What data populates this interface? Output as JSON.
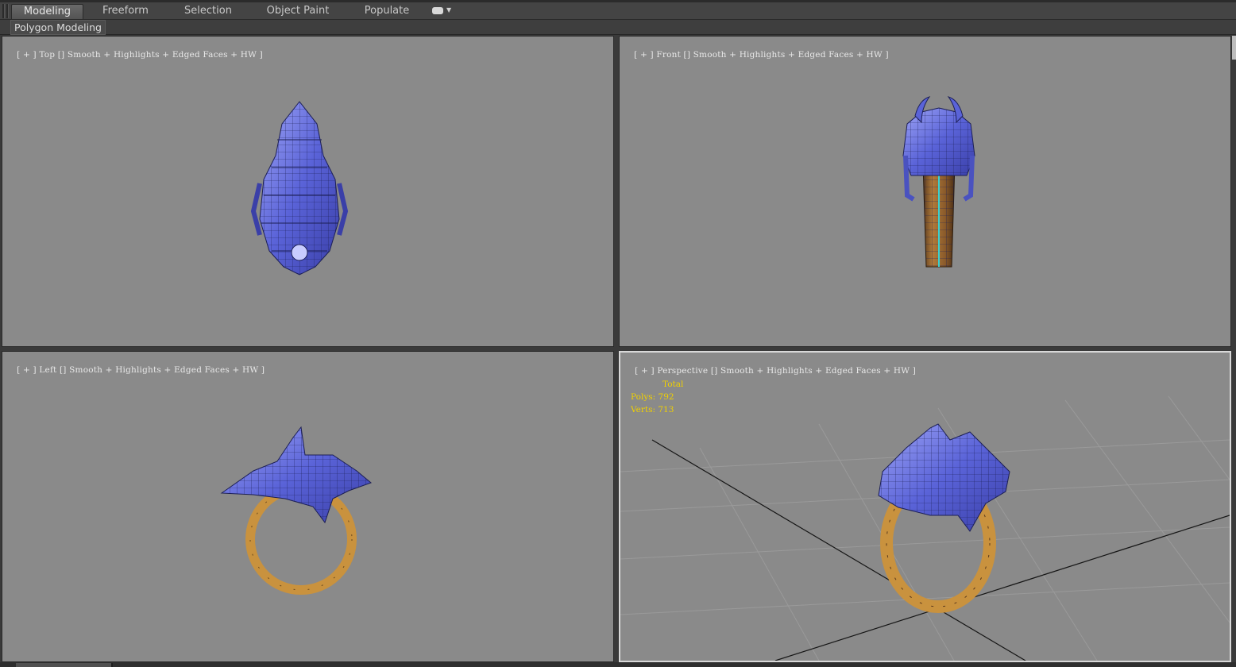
{
  "ribbon": {
    "tabs": [
      {
        "label": "Modeling",
        "active": true
      },
      {
        "label": "Freeform",
        "active": false
      },
      {
        "label": "Selection",
        "active": false
      },
      {
        "label": "Object Paint",
        "active": false
      },
      {
        "label": "Populate",
        "active": false
      }
    ],
    "panel_label": "Polygon Modeling"
  },
  "viewports": {
    "top": {
      "plus": "[ + ]",
      "view": "Top",
      "shading": "Smooth + Highlights + Edged Faces + HW ]"
    },
    "front": {
      "plus": "[ + ]",
      "view": "Front",
      "shading": "Smooth + Highlights + Edged Faces + HW ]"
    },
    "left": {
      "plus": "[ + ]",
      "view": "Left",
      "shading": "Smooth + Highlights + Edged Faces + HW ]"
    },
    "persp": {
      "plus": "[ + ]",
      "view": "Perspective",
      "shading": "Smooth + Highlights + Edged Faces + HW ]"
    }
  },
  "stats": {
    "header": "Total",
    "polys_label": "Polys:",
    "polys_value": "792",
    "verts_label": "Verts:",
    "verts_value": "713"
  },
  "colors": {
    "viewport_bg": "#8a8a8a",
    "mesh_blue": "#5a63d8",
    "mesh_gold": "#c9923e",
    "stats_yellow": "#f0d000",
    "active_border": "#d8d8d8"
  },
  "icons": {
    "tab_menu": "toggle-dropdown-icon"
  }
}
